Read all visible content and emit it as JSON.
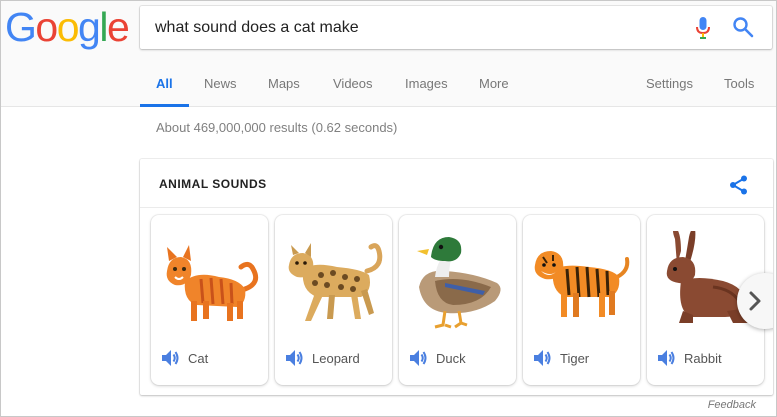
{
  "logo": {
    "letters": [
      "G",
      "o",
      "o",
      "g",
      "l",
      "e"
    ],
    "colors": [
      "#4285F4",
      "#EA4335",
      "#FBBC05",
      "#4285F4",
      "#34A853",
      "#EA4335"
    ]
  },
  "search": {
    "query": "what sound does a cat make"
  },
  "tabs": [
    {
      "label": "All",
      "active": true
    },
    {
      "label": "News"
    },
    {
      "label": "Maps"
    },
    {
      "label": "Videos"
    },
    {
      "label": "Images"
    },
    {
      "label": "More"
    },
    {
      "label": "Settings"
    },
    {
      "label": "Tools"
    }
  ],
  "stats": "About 469,000,000 results (0.62 seconds)",
  "card": {
    "title": "ANIMAL SOUNDS",
    "animals": [
      {
        "label": "Cat",
        "icon": "cat-illustration"
      },
      {
        "label": "Leopard",
        "icon": "leopard-illustration"
      },
      {
        "label": "Duck",
        "icon": "duck-illustration"
      },
      {
        "label": "Tiger",
        "icon": "tiger-illustration"
      },
      {
        "label": "Rabbit",
        "icon": "rabbit-illustration"
      }
    ]
  },
  "feedback": "Feedback",
  "colors": {
    "accent": "#1a73e8",
    "speaker": "#4a7fe0"
  }
}
